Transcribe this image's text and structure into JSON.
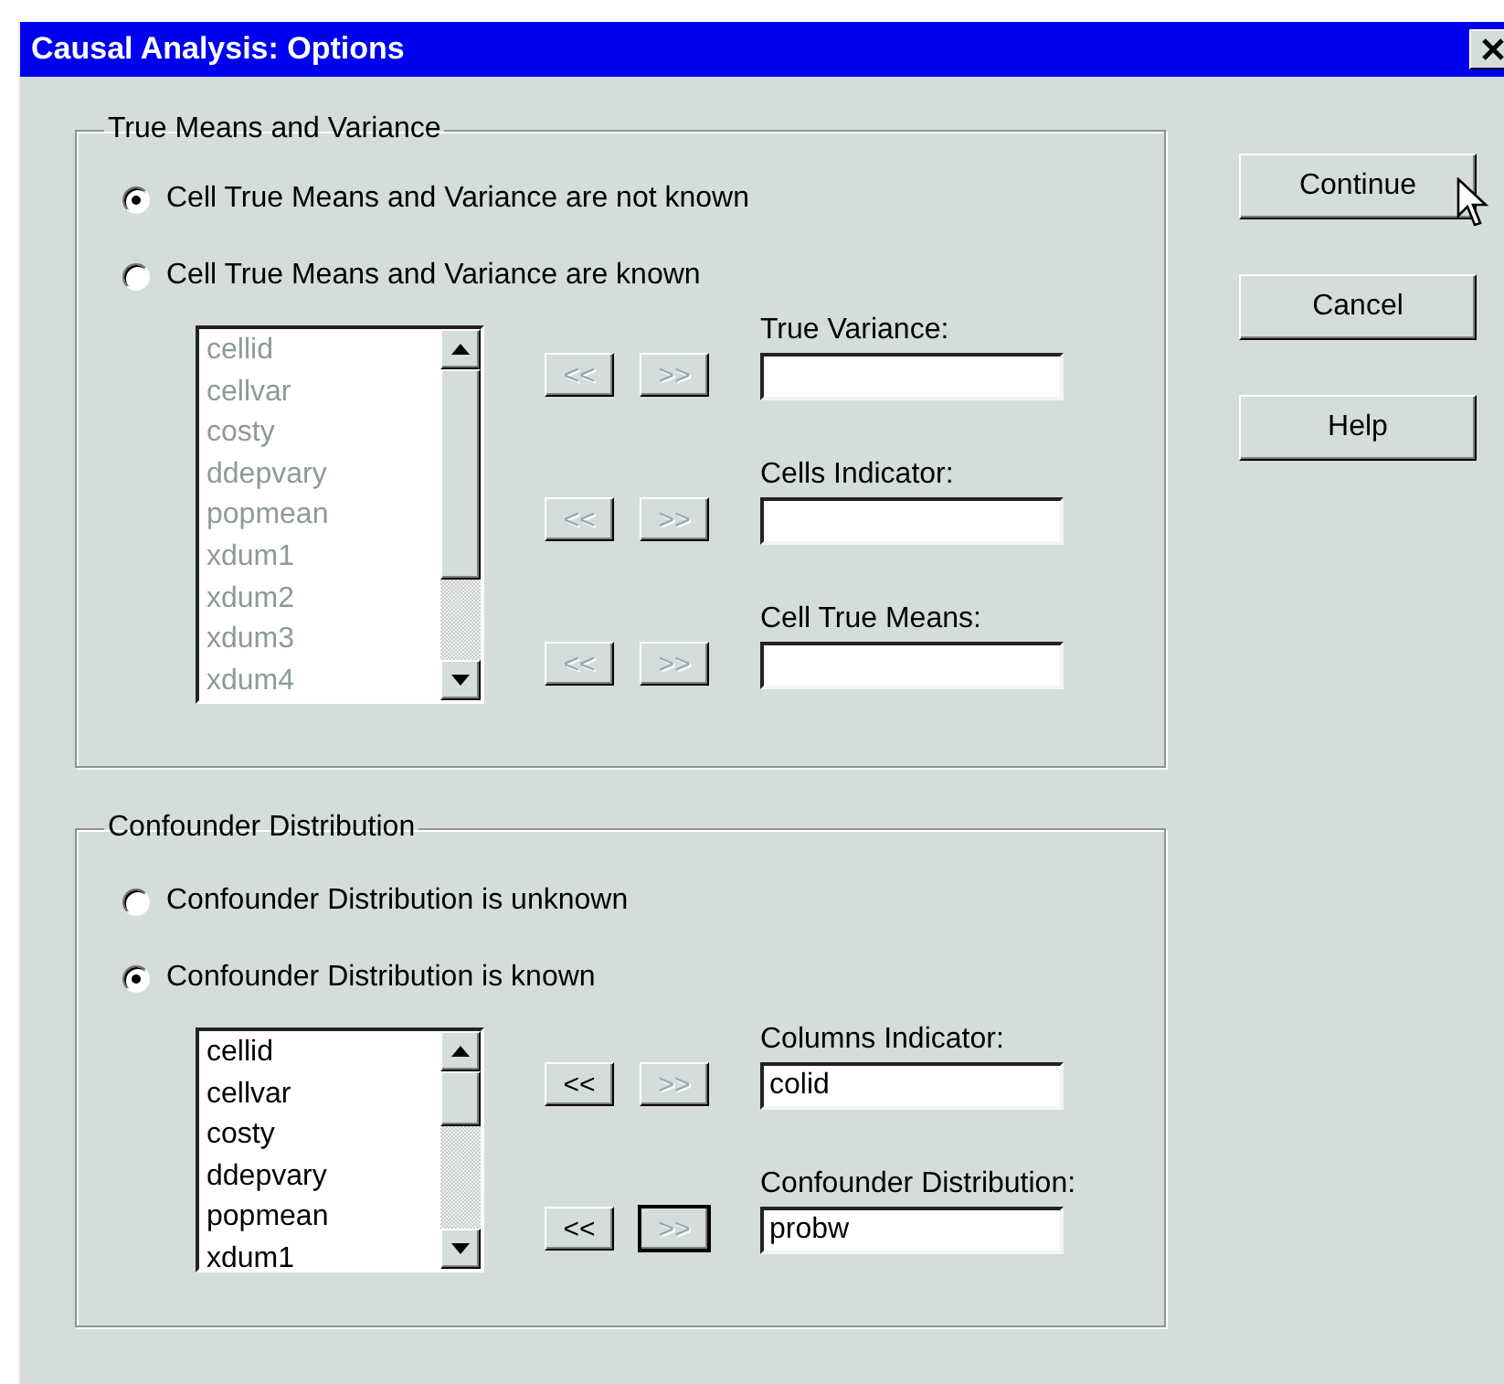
{
  "window": {
    "title": "Causal Analysis: Options"
  },
  "groups": [
    {
      "title": "True Means and Variance",
      "radios": [
        {
          "label": "Cell True Means and Variance are not known",
          "selected": true
        },
        {
          "label": "Cell True Means and Variance are known",
          "selected": false
        }
      ],
      "list": {
        "disabled": true,
        "items": [
          "cellid",
          "cellvar",
          "costy",
          "ddepvary",
          "popmean",
          "xdum1",
          "xdum2",
          "xdum3",
          "xdum4"
        ]
      },
      "targets": [
        {
          "label": "True Variance:",
          "buttons": [
            {
              "label": "<<",
              "enabled": false,
              "focused": false
            },
            {
              "label": ">>",
              "enabled": false,
              "focused": false
            }
          ]
        },
        {
          "label": "Cells Indicator:",
          "buttons": [
            {
              "label": "<<",
              "enabled": false,
              "focused": false
            },
            {
              "label": ">>",
              "enabled": false,
              "focused": false
            }
          ]
        },
        {
          "label": "Cell True Means:",
          "buttons": [
            {
              "label": "<<",
              "enabled": false,
              "focused": false
            },
            {
              "label": ">>",
              "enabled": false,
              "focused": false
            }
          ]
        }
      ]
    },
    {
      "title": "Confounder Distribution",
      "radios": [
        {
          "label": "Confounder Distribution is unknown",
          "selected": false
        },
        {
          "label": "Confounder Distribution is known",
          "selected": true
        }
      ],
      "list": {
        "disabled": false,
        "items": [
          "cellid",
          "cellvar",
          "costy",
          "ddepvary",
          "popmean",
          "xdum1"
        ]
      },
      "targets": [
        {
          "label": "Columns Indicator:",
          "value": "colid",
          "buttons": [
            {
              "label": "<<",
              "enabled": true,
              "focused": false
            },
            {
              "label": ">>",
              "enabled": false,
              "focused": false
            }
          ]
        },
        {
          "label": "Confounder Distribution:",
          "value": "probw",
          "buttons": [
            {
              "label": "<<",
              "enabled": true,
              "focused": false
            },
            {
              "label": ">>",
              "enabled": false,
              "focused": true
            }
          ]
        }
      ]
    }
  ],
  "buttons": [
    {
      "label": "Continue",
      "hovered": true
    },
    {
      "label": "Cancel",
      "hovered": false
    },
    {
      "label": "Help",
      "hovered": false
    }
  ]
}
